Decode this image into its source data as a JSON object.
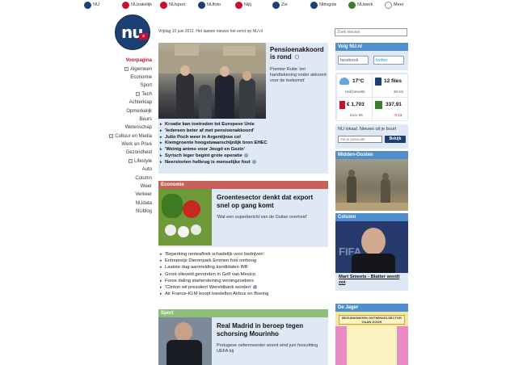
{
  "topbar": {
    "items": [
      {
        "label": "NU",
        "icon": "nu-icon",
        "color": "#1c3f74"
      },
      {
        "label": "NUzakelijk",
        "icon": "nuzakelijk-icon",
        "color": "#c8102e"
      },
      {
        "label": "NUsport",
        "icon": "nusport-icon",
        "color": "#c8102e"
      },
      {
        "label": "NUfoto",
        "icon": "nufoto-icon",
        "color": "#1c3f74"
      },
      {
        "label": "Nijij",
        "icon": "nijij-icon",
        "color": "#c8102e"
      },
      {
        "label": "Zie",
        "icon": "zie-icon",
        "color": "#1c3f74"
      },
      {
        "label": "Nbtvgids",
        "icon": "tvgids-icon",
        "color": "#1c3f74"
      },
      {
        "label": "NUwerk",
        "icon": "nuwerk-icon",
        "color": "#3a7d2c"
      },
      {
        "label": "Meer",
        "icon": "meer-icon",
        "color": "#888888"
      }
    ]
  },
  "logo": {
    "text": "nu",
    "badge": "nl"
  },
  "datebar": {
    "text": "Vrijdag 10 juni 2011. Het laatste nieuws het eerst op NU.nl"
  },
  "search": {
    "placeholder": "Zoek nieuws"
  },
  "nav": {
    "items": [
      {
        "label": "Voorpagina",
        "active": true,
        "plus": false
      },
      {
        "label": "Algemeen",
        "active": false,
        "plus": true
      },
      {
        "label": "Economie",
        "active": false,
        "plus": false
      },
      {
        "label": "Sport",
        "active": false,
        "plus": false
      },
      {
        "label": "Tech",
        "active": false,
        "plus": true
      },
      {
        "label": "Achterklap",
        "active": false,
        "plus": false
      },
      {
        "label": "Opmerkelijk",
        "active": false,
        "plus": false
      },
      {
        "label": "Beurs",
        "active": false,
        "plus": false
      },
      {
        "label": "Wetenschap",
        "active": false,
        "plus": false
      },
      {
        "label": "Cultuur en Media",
        "active": false,
        "plus": true
      },
      {
        "label": "Werk en Privé",
        "active": false,
        "plus": false
      },
      {
        "label": "Gezondheid",
        "active": false,
        "plus": false
      },
      {
        "label": "Lifestyle",
        "active": false,
        "plus": true
      },
      {
        "label": "Auto",
        "active": false,
        "plus": false
      },
      {
        "label": "Column",
        "active": false,
        "plus": false
      },
      {
        "label": "Weer",
        "active": false,
        "plus": false
      },
      {
        "label": "Verkeer",
        "active": false,
        "plus": false
      },
      {
        "label": "NUdata",
        "active": false,
        "plus": false
      },
      {
        "label": "NUblog",
        "active": false,
        "plus": false
      }
    ]
  },
  "hero": {
    "title": "Pensioenakkoord is rond",
    "text": "Premier Rutte 'zet handtekening onder akkoord voor de toekomst'",
    "list": [
      {
        "text": "Kroatie kan toetreden tot Europese Unie",
        "video": false
      },
      {
        "text": "'Iedereen beter af met pensioenakkoord'",
        "video": false
      },
      {
        "text": "Julio Poch weer in Argentijnse cel",
        "video": false
      },
      {
        "text": "Kiemgroente hoogstwaarschijnlijk bron EHEC",
        "video": false
      },
      {
        "text": "'Weinig animo voor Jeugd en Gezin'",
        "video": false
      },
      {
        "text": "Syrisch leger begint grote operatie",
        "video": true
      },
      {
        "text": "Neerstorten helbrug is menselijke fout",
        "video": true
      }
    ]
  },
  "economie": {
    "header": "Economie",
    "title": "Groentesector denkt dat export snel op gang komt",
    "text": "'Wat een superbericht van de Duitse overheid'",
    "list": [
      {
        "text": "'Beperking renteaftrek schadelijk voor bedrijven'",
        "video": false
      },
      {
        "text": "Entrepreijs Dierenpark Emmen fors omhoog",
        "video": false
      },
      {
        "text": "Laatste dag aanmelding kandidaten IMF",
        "video": false
      },
      {
        "text": "Groot olieveld gevonden in Golf van Mexico",
        "video": false
      },
      {
        "text": "Forse daling startersleining woningzoekers",
        "video": false
      },
      {
        "text": "'Clinton wil president Wereldbank worden'",
        "video": true
      },
      {
        "text": "Air France-KLM koopt toestellen Airbus en Boeing",
        "video": false
      }
    ]
  },
  "sport": {
    "header": "Sport",
    "title": "Real Madrid in beroep tegen schorsing Mourinho",
    "text": "Portugese oefenmeester woont eind juni hoorzitting UEFA bij"
  },
  "volg": {
    "header": "Volg NU.nl",
    "facebook": "facebook",
    "twitter": "twitter"
  },
  "widgets": {
    "weather_temp": "17°C",
    "weather_sub": "Half bewolkt",
    "traffic": "12 files",
    "traffic_sub": "30 km",
    "fuel": "€ 1,703",
    "fuel_sub": "Euro 95",
    "aex": "337,91",
    "aex_sub": "-0,13"
  },
  "local": {
    "text": "NU lokaal. Nieuws uit je buurt",
    "placeholder": "Vul je postcode",
    "button": "Bekijk"
  },
  "middenoosten": {
    "header": "Midden-Oosten"
  },
  "column": {
    "header": "Column",
    "link": "Mart Smeets - Blatter wordt zot",
    "photo_text": "FIFA"
  },
  "dejager": {
    "header": "De Jager",
    "cartoon_text": "BEZUINIGINGEN ONTWIKKELSECTOR GAAN DOOR"
  },
  "colors": {
    "brand": "#1c3f74",
    "accent_red": "#c8102e",
    "section_blue": "#4f8fcd",
    "panel_bg": "#dfe9f5",
    "economie": "#c8605a",
    "sport": "#8cc07a"
  }
}
